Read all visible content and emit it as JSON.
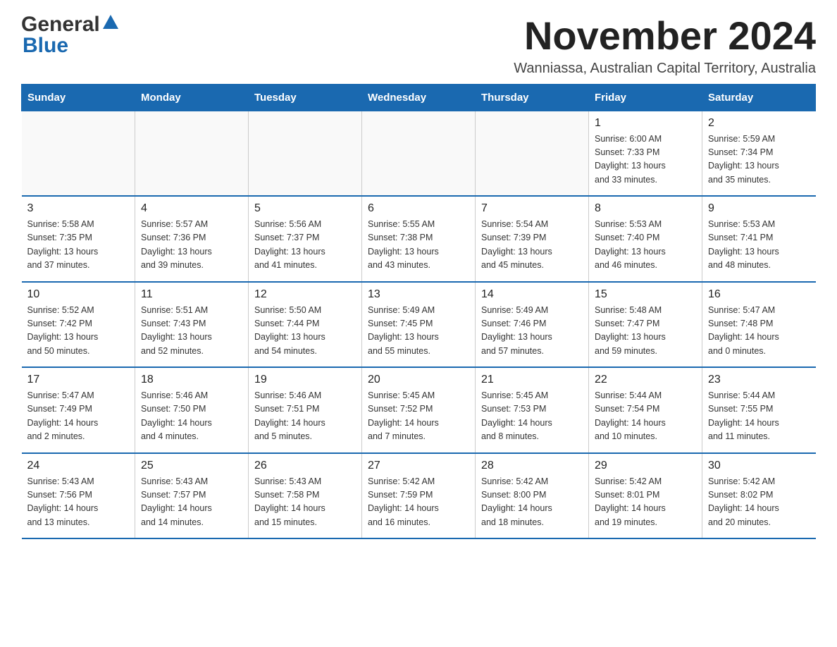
{
  "logo": {
    "general": "General",
    "blue": "Blue"
  },
  "header": {
    "month_year": "November 2024",
    "location": "Wanniassa, Australian Capital Territory, Australia"
  },
  "weekdays": [
    "Sunday",
    "Monday",
    "Tuesday",
    "Wednesday",
    "Thursday",
    "Friday",
    "Saturday"
  ],
  "weeks": [
    [
      {
        "day": "",
        "info": ""
      },
      {
        "day": "",
        "info": ""
      },
      {
        "day": "",
        "info": ""
      },
      {
        "day": "",
        "info": ""
      },
      {
        "day": "",
        "info": ""
      },
      {
        "day": "1",
        "info": "Sunrise: 6:00 AM\nSunset: 7:33 PM\nDaylight: 13 hours\nand 33 minutes."
      },
      {
        "day": "2",
        "info": "Sunrise: 5:59 AM\nSunset: 7:34 PM\nDaylight: 13 hours\nand 35 minutes."
      }
    ],
    [
      {
        "day": "3",
        "info": "Sunrise: 5:58 AM\nSunset: 7:35 PM\nDaylight: 13 hours\nand 37 minutes."
      },
      {
        "day": "4",
        "info": "Sunrise: 5:57 AM\nSunset: 7:36 PM\nDaylight: 13 hours\nand 39 minutes."
      },
      {
        "day": "5",
        "info": "Sunrise: 5:56 AM\nSunset: 7:37 PM\nDaylight: 13 hours\nand 41 minutes."
      },
      {
        "day": "6",
        "info": "Sunrise: 5:55 AM\nSunset: 7:38 PM\nDaylight: 13 hours\nand 43 minutes."
      },
      {
        "day": "7",
        "info": "Sunrise: 5:54 AM\nSunset: 7:39 PM\nDaylight: 13 hours\nand 45 minutes."
      },
      {
        "day": "8",
        "info": "Sunrise: 5:53 AM\nSunset: 7:40 PM\nDaylight: 13 hours\nand 46 minutes."
      },
      {
        "day": "9",
        "info": "Sunrise: 5:53 AM\nSunset: 7:41 PM\nDaylight: 13 hours\nand 48 minutes."
      }
    ],
    [
      {
        "day": "10",
        "info": "Sunrise: 5:52 AM\nSunset: 7:42 PM\nDaylight: 13 hours\nand 50 minutes."
      },
      {
        "day": "11",
        "info": "Sunrise: 5:51 AM\nSunset: 7:43 PM\nDaylight: 13 hours\nand 52 minutes."
      },
      {
        "day": "12",
        "info": "Sunrise: 5:50 AM\nSunset: 7:44 PM\nDaylight: 13 hours\nand 54 minutes."
      },
      {
        "day": "13",
        "info": "Sunrise: 5:49 AM\nSunset: 7:45 PM\nDaylight: 13 hours\nand 55 minutes."
      },
      {
        "day": "14",
        "info": "Sunrise: 5:49 AM\nSunset: 7:46 PM\nDaylight: 13 hours\nand 57 minutes."
      },
      {
        "day": "15",
        "info": "Sunrise: 5:48 AM\nSunset: 7:47 PM\nDaylight: 13 hours\nand 59 minutes."
      },
      {
        "day": "16",
        "info": "Sunrise: 5:47 AM\nSunset: 7:48 PM\nDaylight: 14 hours\nand 0 minutes."
      }
    ],
    [
      {
        "day": "17",
        "info": "Sunrise: 5:47 AM\nSunset: 7:49 PM\nDaylight: 14 hours\nand 2 minutes."
      },
      {
        "day": "18",
        "info": "Sunrise: 5:46 AM\nSunset: 7:50 PM\nDaylight: 14 hours\nand 4 minutes."
      },
      {
        "day": "19",
        "info": "Sunrise: 5:46 AM\nSunset: 7:51 PM\nDaylight: 14 hours\nand 5 minutes."
      },
      {
        "day": "20",
        "info": "Sunrise: 5:45 AM\nSunset: 7:52 PM\nDaylight: 14 hours\nand 7 minutes."
      },
      {
        "day": "21",
        "info": "Sunrise: 5:45 AM\nSunset: 7:53 PM\nDaylight: 14 hours\nand 8 minutes."
      },
      {
        "day": "22",
        "info": "Sunrise: 5:44 AM\nSunset: 7:54 PM\nDaylight: 14 hours\nand 10 minutes."
      },
      {
        "day": "23",
        "info": "Sunrise: 5:44 AM\nSunset: 7:55 PM\nDaylight: 14 hours\nand 11 minutes."
      }
    ],
    [
      {
        "day": "24",
        "info": "Sunrise: 5:43 AM\nSunset: 7:56 PM\nDaylight: 14 hours\nand 13 minutes."
      },
      {
        "day": "25",
        "info": "Sunrise: 5:43 AM\nSunset: 7:57 PM\nDaylight: 14 hours\nand 14 minutes."
      },
      {
        "day": "26",
        "info": "Sunrise: 5:43 AM\nSunset: 7:58 PM\nDaylight: 14 hours\nand 15 minutes."
      },
      {
        "day": "27",
        "info": "Sunrise: 5:42 AM\nSunset: 7:59 PM\nDaylight: 14 hours\nand 16 minutes."
      },
      {
        "day": "28",
        "info": "Sunrise: 5:42 AM\nSunset: 8:00 PM\nDaylight: 14 hours\nand 18 minutes."
      },
      {
        "day": "29",
        "info": "Sunrise: 5:42 AM\nSunset: 8:01 PM\nDaylight: 14 hours\nand 19 minutes."
      },
      {
        "day": "30",
        "info": "Sunrise: 5:42 AM\nSunset: 8:02 PM\nDaylight: 14 hours\nand 20 minutes."
      }
    ]
  ]
}
